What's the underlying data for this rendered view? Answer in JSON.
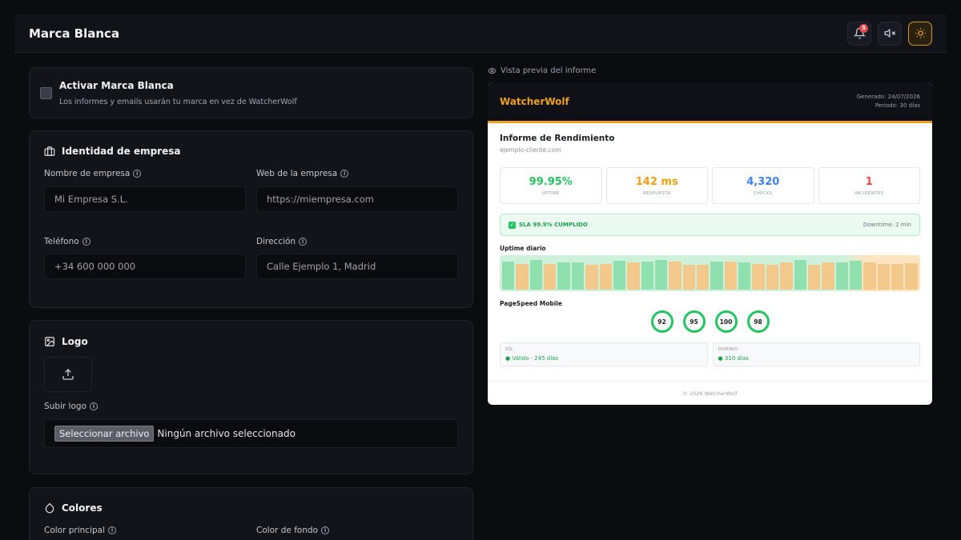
{
  "header": {
    "title": "Marca Blanca",
    "notification_count": "5"
  },
  "activate": {
    "title": "Activar Marca Blanca",
    "description": "Los informes y emails usarán tu marca en vez de WatcherWolf",
    "checked": false
  },
  "identity": {
    "title": "Identidad de empresa",
    "company_name": {
      "label": "Nombre de empresa",
      "placeholder": "Mi Empresa S.L."
    },
    "website": {
      "label": "Web de la empresa",
      "placeholder": "https://miempresa.com"
    },
    "phone": {
      "label": "Teléfono",
      "placeholder": "+34 600 000 000"
    },
    "address": {
      "label": "Dirección",
      "placeholder": "Calle Ejemplo 1, Madrid"
    }
  },
  "logo": {
    "title": "Logo",
    "upload_label": "Subir logo",
    "file_button": "Seleccionar archivo",
    "file_status": "Ningún archivo seleccionado"
  },
  "colors": {
    "title": "Colores",
    "primary_label": "Color principal",
    "background_label": "Color de fondo"
  },
  "preview": {
    "label": "Vista previa del informe",
    "brand": "WatcherWolf",
    "generated": "Generado: 24/07/2026",
    "period": "Periodo: 30 días",
    "report_title": "Informe de Rendimiento",
    "site": "ejemplo-cliente.com",
    "stats": [
      {
        "value": "99.95%",
        "label": "UPTIME",
        "color": "#22c55e"
      },
      {
        "value": "142 ms",
        "label": "RESPUESTA",
        "color": "#f59e0b"
      },
      {
        "value": "4,320",
        "label": "CHECKS",
        "color": "#3b82f6"
      },
      {
        "value": "1",
        "label": "INCIDENTES",
        "color": "#ef4444"
      }
    ],
    "sla_text": "SLA 99.9% CUMPLIDO",
    "downtime": "Downtime: 2 min",
    "uptime_title": "Uptime diario",
    "uptime_bars": [
      {
        "level": 0.88,
        "status": "up"
      },
      {
        "level": 0.8,
        "status": "warn"
      },
      {
        "level": 0.92,
        "status": "up"
      },
      {
        "level": 0.8,
        "status": "warn"
      },
      {
        "level": 0.86,
        "status": "up"
      },
      {
        "level": 0.86,
        "status": "up"
      },
      {
        "level": 0.78,
        "status": "warn"
      },
      {
        "level": 0.8,
        "status": "warn"
      },
      {
        "level": 0.9,
        "status": "up"
      },
      {
        "level": 0.84,
        "status": "warn"
      },
      {
        "level": 0.88,
        "status": "up"
      },
      {
        "level": 0.92,
        "status": "up"
      },
      {
        "level": 0.88,
        "status": "warn"
      },
      {
        "level": 0.78,
        "status": "warn"
      },
      {
        "level": 0.78,
        "status": "warn"
      },
      {
        "level": 0.88,
        "status": "up"
      },
      {
        "level": 0.88,
        "status": "warn"
      },
      {
        "level": 0.86,
        "status": "up"
      },
      {
        "level": 0.8,
        "status": "warn"
      },
      {
        "level": 0.78,
        "status": "warn"
      },
      {
        "level": 0.84,
        "status": "warn"
      },
      {
        "level": 0.92,
        "status": "up"
      },
      {
        "level": 0.78,
        "status": "warn"
      },
      {
        "level": 0.84,
        "status": "warn"
      },
      {
        "level": 0.86,
        "status": "up"
      },
      {
        "level": 0.9,
        "status": "up"
      },
      {
        "level": 0.86,
        "status": "warn"
      },
      {
        "level": 0.8,
        "status": "warn"
      },
      {
        "level": 0.8,
        "status": "warn"
      },
      {
        "level": 0.82,
        "status": "warn"
      }
    ],
    "pagespeed_title": "PageSpeed Mobile",
    "scores": [
      "92",
      "95",
      "100",
      "98"
    ],
    "ssl": {
      "label": "SSL",
      "value": "● Válido · 245 días"
    },
    "domain": {
      "label": "DOMINIO",
      "value": "● 310 días"
    },
    "footer": "© 2026 WatcherWolf"
  }
}
